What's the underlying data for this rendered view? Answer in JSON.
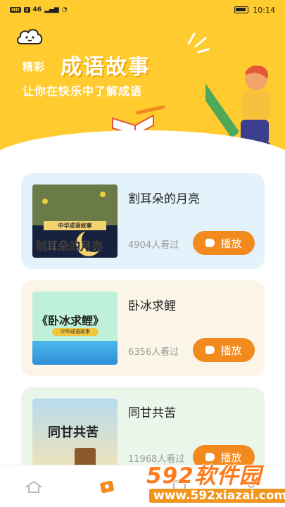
{
  "status_bar": {
    "left_chips": [
      "HD",
      "2"
    ],
    "signal": "46",
    "time": "10:14"
  },
  "header": {
    "title_small": "精彩",
    "title_big": "成语故事",
    "subtitle": "让你在快乐中了解成语",
    "colors": {
      "background": "#ffcb2f",
      "accent": "#f28a1e"
    }
  },
  "stories": [
    {
      "title": "割耳朵的月亮",
      "views": "4904人看过",
      "play_label": "播放",
      "thumb_banner": "中华成语故事",
      "thumb_text": "割耳朵的月亮"
    },
    {
      "title": "卧冰求鲤",
      "views": "6356人看过",
      "play_label": "播放",
      "thumb_text": "《卧冰求鲤》",
      "thumb_banner": "中华成语故事"
    },
    {
      "title": "同甘共苦",
      "views": "11968人看过",
      "play_label": "播放",
      "thumb_text": "同甘共苦"
    }
  ],
  "bottom_nav": {
    "icons": [
      "home-icon",
      "play-icon",
      "book-icon",
      "user-icon"
    ]
  },
  "watermark": {
    "brand_num": "592",
    "brand_cn": "软件园",
    "url": "www.592xiazai.com"
  }
}
